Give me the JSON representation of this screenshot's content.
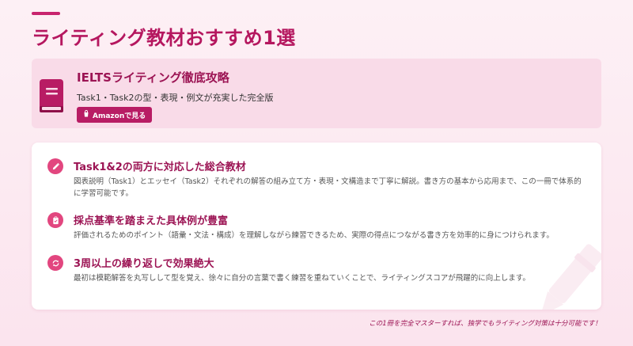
{
  "page": {
    "title": "ライティング教材おすすめ1選"
  },
  "book": {
    "icon": "book-icon",
    "title": "IELTSライティング徹底攻略",
    "subtitle": "Task1・Task2の型・表現・例文が充実した完全版",
    "button_label": "Amazonで見る",
    "button_icon": "amazon-icon"
  },
  "features": [
    {
      "icon": "pencil-icon",
      "title": "Task1&2の両方に対応した総合教材",
      "description": "図表説明（Task1）とエッセイ（Task2）それぞれの解答の組み立て方・表現・文構造まで丁寧に解説。書き方の基本から応用まで、この一冊で体系的に学習可能です。"
    },
    {
      "icon": "clipboard-icon",
      "title": "採点基準を踏まえた具体例が豊富",
      "description": "評価されるためのポイント（語彙・文法・構成）を理解しながら練習できるため、実際の得点につながる書き方を効率的に身につけられます。"
    },
    {
      "icon": "repeat-icon",
      "title": "3周以上の繰り返しで効果絶大",
      "description": "最初は模範解答を丸写しして型を覚え、徐々に自分の言葉で書く練習を重ねていくことで、ライティングスコアが飛躍的に向上します。"
    }
  ],
  "footer": {
    "note": "この1冊を完全マスターすれば、独学でもライティング対策は十分可能です！"
  },
  "colors": {
    "accent": "#c8246e",
    "title": "#b5175f",
    "card_bg": "#f9dbe8",
    "icon_bg": "#e2467f"
  }
}
